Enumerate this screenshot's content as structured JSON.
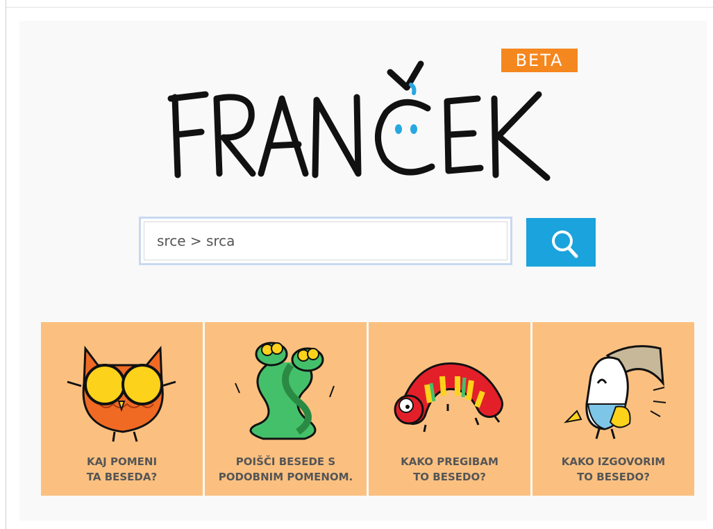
{
  "logo": {
    "text": "FRANČEK",
    "badge": "BETA"
  },
  "search": {
    "value": "srce > srca",
    "button_icon": "search-icon"
  },
  "cards": [
    {
      "label": "KAJ POMENI\nTA BESEDA?",
      "icon": "owl-icon"
    },
    {
      "label": "POIŠČI BESEDE S\nPODOBNIM POMENOM.",
      "icon": "snakes-icon"
    },
    {
      "label": "KAKO PREGIBAM\nTO BESEDO?",
      "icon": "caterpillar-icon"
    },
    {
      "label": "KAKO IZGOVORIM\nTO BESEDO?",
      "icon": "toucan-icon"
    }
  ],
  "colors": {
    "accent": "#1aa3dc",
    "badge": "#f5871f",
    "card": "#fbc080",
    "eyes": "#29a8e0"
  }
}
